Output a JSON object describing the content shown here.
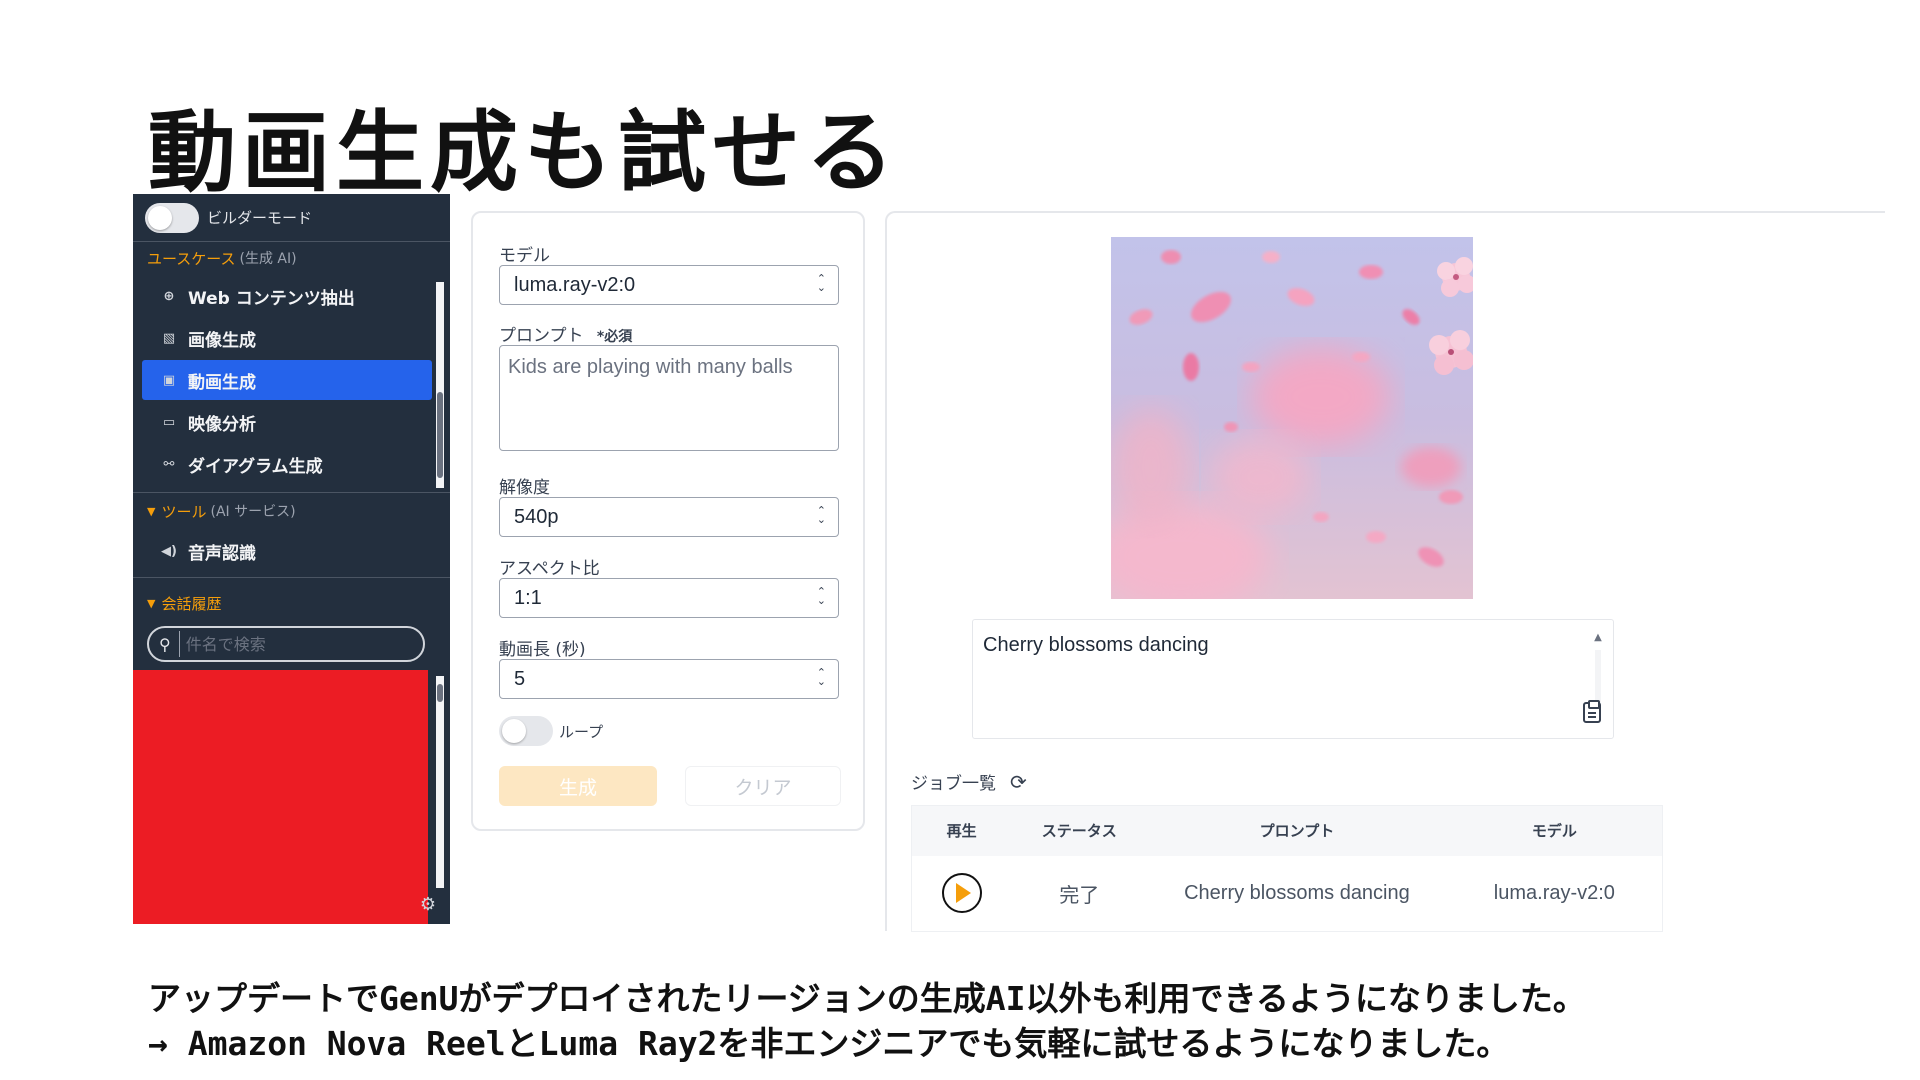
{
  "slide": {
    "title": "動画生成も試せる",
    "footer_line1": "アップデートでGenUがデプロイされたリージョンの生成AI以外も利用できるようになりました。",
    "footer_line2": "→ Amazon Nova ReelとLuma Ray2を非エンジニアでも気軽に試せるようになりました。"
  },
  "sidebar": {
    "builder_mode_label": "ビルダーモード",
    "usecase_section": {
      "label": "ユースケース",
      "sub": "(生成 AI)"
    },
    "items": [
      {
        "label": "Web コンテンツ抽出",
        "icon": "globe-icon"
      },
      {
        "label": "画像生成",
        "icon": "image-icon"
      },
      {
        "label": "動画生成",
        "icon": "video-icon",
        "active": true
      },
      {
        "label": "映像分析",
        "icon": "camera-icon"
      },
      {
        "label": "ダイアグラム生成",
        "icon": "diagram-icon"
      }
    ],
    "tools_section": {
      "label": "ツール",
      "sub": "(AI サービス)"
    },
    "tools_items": [
      {
        "label": "音声認識",
        "icon": "speaker-icon"
      }
    ],
    "history_section": {
      "label": "会話履歴"
    },
    "search_placeholder": "件名で検索"
  },
  "form": {
    "model_label": "モデル",
    "model_value": "luma.ray-v2:0",
    "prompt_label": "プロンプト",
    "prompt_required": "*必須",
    "prompt_placeholder": "Kids are playing with many balls",
    "resolution_label": "解像度",
    "resolution_value": "540p",
    "aspect_label": "アスペクト比",
    "aspect_value": "1:1",
    "duration_label": "動画長 (秒)",
    "duration_value": "5",
    "loop_label": "ループ",
    "loop_enabled": false,
    "generate_button": "生成",
    "clear_button": "クリア"
  },
  "result": {
    "caption": "Cherry blossoms dancing",
    "jobs_label": "ジョブ一覧",
    "table": {
      "headers": [
        "再生",
        "ステータス",
        "プロンプト",
        "モデル"
      ],
      "rows": [
        {
          "status": "完了",
          "prompt": "Cherry blossoms dancing",
          "model": "luma.ray-v2:0"
        }
      ]
    }
  },
  "colors": {
    "sidebar_bg": "#232f3e",
    "accent_orange": "#f59e0b",
    "active_blue": "#2563eb",
    "generate_disabled": "#fde7c2",
    "redacted": "#ec1c24"
  }
}
